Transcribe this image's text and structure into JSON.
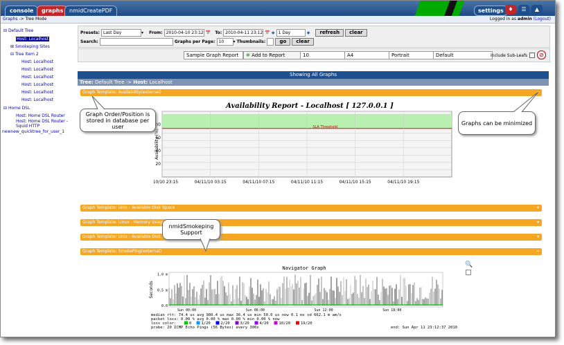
{
  "tabs": {
    "console": "console",
    "graphs": "graphs",
    "pdf": "nmidCreatePDF",
    "settings": "settings"
  },
  "breadcrumb": {
    "graphs": "Graphs",
    "sep": " -> ",
    "mode": "Tree Mode"
  },
  "login": {
    "prefix": "Logged in as ",
    "user": "admin",
    "logout": "(Logout)"
  },
  "tree": {
    "items": [
      {
        "label": "Default Tree"
      },
      {
        "label": "Host: Localhost"
      },
      {
        "label": "Smokeping Sites"
      },
      {
        "label": "Tree Item 2"
      },
      {
        "label": "Host: Localhost"
      },
      {
        "label": "Host: Localhost"
      },
      {
        "label": "Host: Localhost"
      },
      {
        "label": "Host: Localhost"
      },
      {
        "label": "Host: Localhost"
      },
      {
        "label": "Host: Localhost"
      },
      {
        "label": "Home DSL"
      },
      {
        "label": "Host: Home DSL Router"
      },
      {
        "label": "Host: Home DSL Router - Squid HTTP"
      },
      {
        "label": "newnew_quicktree_for_user_1"
      }
    ]
  },
  "filters": {
    "presets_label": "Presets:",
    "presets_value": "Last Day",
    "from_label": "From:",
    "from_value": "2010-04-10 23:12",
    "to_label": "To:",
    "to_value": "2010-04-11 23:12",
    "shift_value": "1 Day",
    "refresh": "refresh",
    "clear": "clear",
    "search_label": "Search:",
    "perpage_label": "Graphs per Page:",
    "perpage_value": "10",
    "thumbs_label": "Thumbnails:",
    "go": "go",
    "clear2": "clear"
  },
  "report": {
    "type": "Sample Graph Report",
    "add": "Add to Report",
    "count": "10",
    "paper": "A4",
    "orient": "Portrait",
    "style": "Default",
    "subleafs": "Include Sub-Leafs"
  },
  "showing": "Showing All Graphs",
  "treepath": {
    "tree_label": "Tree:",
    "tree": "Default Tree",
    "host_label": "Host:",
    "host": "Localhost"
  },
  "templates": [
    {
      "label": "Graph Template: Availability(external)",
      "toggle": "−"
    },
    {
      "label": "Graph Template: Unix - Available Disk Space",
      "toggle": "+"
    },
    {
      "label": "Graph Template: Linux - Memory Usage",
      "toggle": "+"
    },
    {
      "label": "Graph Template: Unix - Available Disk Space",
      "toggle": "+"
    },
    {
      "label": "Graph Template: SmokePing(external)",
      "toggle": "−"
    }
  ],
  "callouts": {
    "order": "Graph Order/Position is stored in database per user",
    "minimize": "Graphs can be minimized",
    "smoke": "nmidSmokeping Support"
  },
  "chart_data": [
    {
      "type": "area",
      "title": "Availability Report - Localhost [ 127.0.0.1 ]",
      "ylabel": "Availability (%)",
      "threshold_label": "SLA Threshold",
      "x_ticks": [
        "04/10/10 23:15",
        "04/11/10 03:15",
        "04/11/10 07:15",
        "04/11/10 11:15",
        "04/11/10 15:15",
        "04/11/10 19:15"
      ],
      "y_ticks": [
        "20",
        "40",
        "60",
        "80"
      ],
      "threshold_color": "#cc0000",
      "fill_color": "#b8f0b0"
    },
    {
      "type": "area",
      "title": "Navigator Graph",
      "ylabel": "Seconds",
      "y_ticks": [
        "0.0",
        "0.5 m",
        "1.0 m"
      ],
      "x_ticks": [
        "Sun 00:00",
        "Sun 06:00",
        "Sun 12:00",
        "Sun 18:00"
      ],
      "stats": [
        "median rtt:  74.4 us avg  980.4 us max  36.4 us min  50.0 us now  0.1 ms sd  662.1 m am/s",
        "packet loss: 0.00 % avg  0.00 % max  0.00 % min  0.00 % now",
        "probe:         20 ICMP Echo Pings (56 Bytes) every 300s"
      ],
      "loss_label": "loss color:",
      "loss_legend": [
        {
          "label": "0",
          "color": "#00cc00"
        },
        {
          "label": "1/20",
          "color": "#0099ff"
        },
        {
          "label": "2/20",
          "color": "#0000ff"
        },
        {
          "label": "3/20",
          "color": "#8800cc"
        },
        {
          "label": "4/20",
          "color": "#9900ff"
        },
        {
          "label": "10/20",
          "color": "#cc00cc"
        },
        {
          "label": "19/20",
          "color": "#ff0000"
        }
      ],
      "end_label": "end: Sun Apr 11 23:12:37 2010"
    }
  ]
}
